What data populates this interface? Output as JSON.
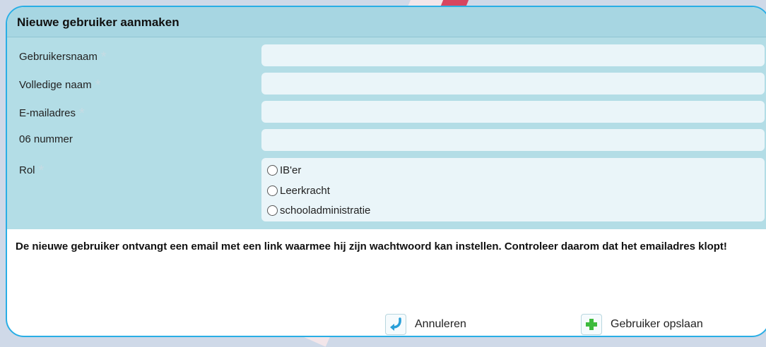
{
  "dialog": {
    "title": "Nieuwe gebruiker aanmaken",
    "required_marker": "*"
  },
  "fields": [
    {
      "label": "Gebruikersnaam",
      "required": true,
      "value": ""
    },
    {
      "label": "Volledige naam",
      "required": true,
      "value": ""
    },
    {
      "label": "E-mailadres",
      "required": true,
      "value": ""
    },
    {
      "label": "06 nummer",
      "required": false,
      "value": ""
    }
  ],
  "role": {
    "label": "Rol",
    "required": true,
    "options": [
      "IB'er",
      "Leerkracht",
      "schooladministratie"
    ],
    "selected": null
  },
  "info_text": "De nieuwe gebruiker ontvangt een email met een link waarmee hij zijn wachtwoord kan instellen. Controleer daarom dat het emailadres klopt!",
  "buttons": {
    "cancel_label": "Annuleren",
    "save_label": "Gebruiker opslaan"
  },
  "colors": {
    "accent_border": "#29aee5",
    "header_bg": "#a7d6e2",
    "form_bg": "#b3dde6",
    "cancel_icon": "#2a9fd8",
    "save_icon": "#3dbb3d"
  },
  "icons": {
    "cancel": "return-arrow-icon",
    "save": "plus-icon"
  }
}
